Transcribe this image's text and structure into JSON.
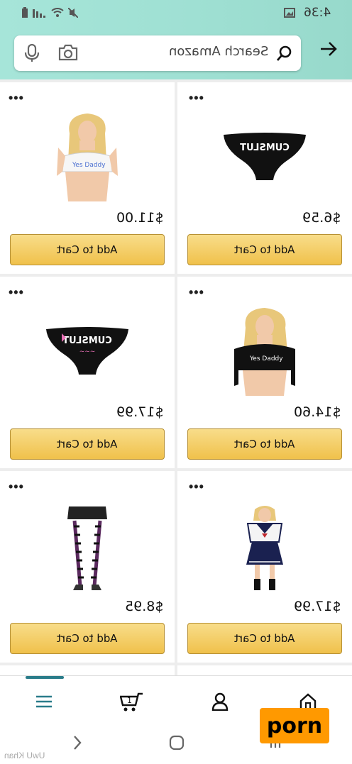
{
  "status": {
    "time": "4:36"
  },
  "search": {
    "placeholder": "Search Amazon"
  },
  "products": [
    {
      "name": "product-white-crop-top",
      "price": "$11.00",
      "button": "Add to Cart",
      "icon": "crop-top-image"
    },
    {
      "name": "product-black-panties-cumslut",
      "price": "$6.59",
      "button": "Add to Cart",
      "icon": "panties-image",
      "print": "CUMSLUT"
    },
    {
      "name": "product-black-panties-pink",
      "price": "$17.99",
      "button": "Add to Cart",
      "icon": "panties-image",
      "print": "CUMSLUT"
    },
    {
      "name": "product-black-crop-top",
      "price": "$14.60",
      "button": "Add to Cart",
      "icon": "crop-top-image"
    },
    {
      "name": "product-striped-stockings",
      "price": "$8.95",
      "button": "Add to Cart",
      "icon": "stockings-image"
    },
    {
      "name": "product-school-uniform",
      "price": "$17.99",
      "button": "Add to Cart",
      "icon": "uniform-image"
    }
  ],
  "bottom_nav": {
    "items": [
      "menu-icon",
      "cart-icon",
      "account-icon",
      "home-icon"
    ],
    "accent": "#2a7c8a"
  },
  "overlay": {
    "watermark_user": "UwU Khan",
    "brand_badge": "porn"
  },
  "colors": {
    "header_gradient_start": "#a6e5d9",
    "button_fill": "#f0c14b",
    "badge": "#ff9900"
  }
}
